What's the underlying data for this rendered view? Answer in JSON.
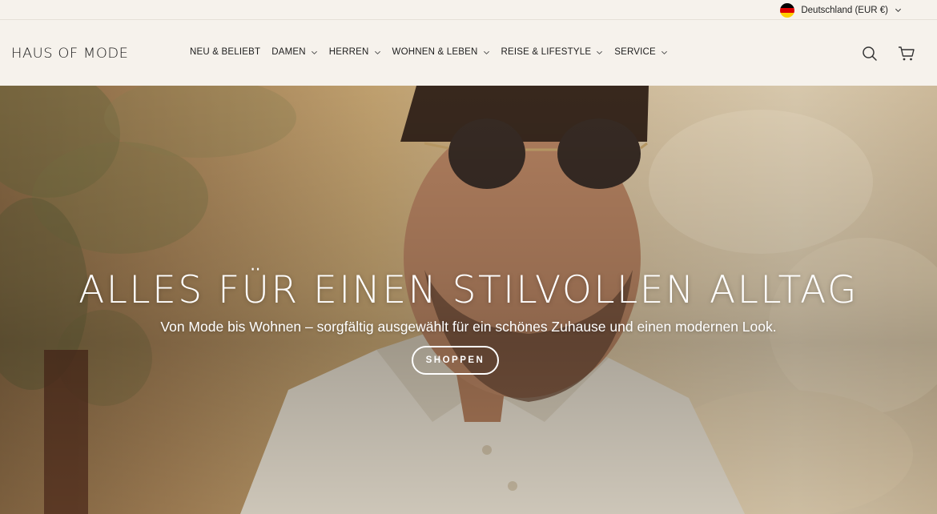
{
  "topbar": {
    "country_label": "Deutschland (EUR €)",
    "flag_colors": [
      "#000000",
      "#dd0000",
      "#ffce00"
    ]
  },
  "header": {
    "logo": "HAUS OF MODE",
    "nav": [
      {
        "label": "NEU & BELIEBT",
        "has_dropdown": false
      },
      {
        "label": "DAMEN",
        "has_dropdown": true
      },
      {
        "label": "HERREN",
        "has_dropdown": true
      },
      {
        "label": "WOHNEN & LEBEN",
        "has_dropdown": true
      },
      {
        "label": "REISE & LIFESTYLE",
        "has_dropdown": true
      },
      {
        "label": "SERVICE",
        "has_dropdown": true
      }
    ],
    "icons": [
      "search-icon",
      "cart-icon"
    ]
  },
  "hero": {
    "title": "ALLES FÜR EINEN STILVOLLEN ALLTAG",
    "subtitle": "Von Mode bis Wohnen – sorgfältig ausgewählt für ein schönes Zuhause und einen modernen Look.",
    "button_label": "SHOPPEN"
  },
  "colors": {
    "background": "#f6f2ec",
    "text": "#1d1d1d",
    "hero_text": "#ffffff"
  }
}
